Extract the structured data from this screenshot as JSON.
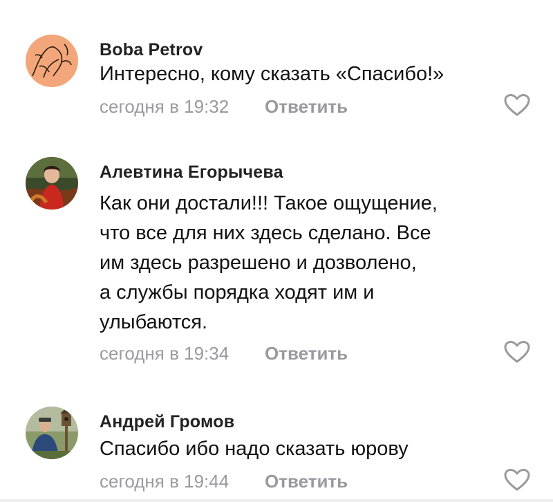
{
  "comments": [
    {
      "author": "Boba Petrov",
      "lines": [
        "Интересно, кому сказать «Спасибо!»"
      ],
      "time": "сегодня в 19:32",
      "reply_label": "Ответить",
      "avatar_icon": "sketch-avatar-icon"
    },
    {
      "author": "Алевтина Егорычева",
      "lines": [
        "Как они достали!!! Такое ощущение,",
        "что все для них здесь сделано. Все",
        "им здесь разрешено и дозволено,",
        "а службы порядка ходят им и",
        "улыбаются."
      ],
      "time": "сегодня в 19:34",
      "reply_label": "Ответить",
      "avatar_icon": "photo-avatar-icon"
    },
    {
      "author": "Андрей Громов",
      "lines": [
        "Спасибо ибо надо сказать юрову"
      ],
      "time": "сегодня в 19:44",
      "reply_label": "Ответить",
      "avatar_icon": "photo-avatar-icon"
    }
  ],
  "colors": {
    "meta_gray": "#9a9a9e",
    "avatar1_bg": "#f2a679",
    "heart_outline": "#9a9a9e"
  },
  "icons": {
    "like": "heart-outline-icon"
  }
}
